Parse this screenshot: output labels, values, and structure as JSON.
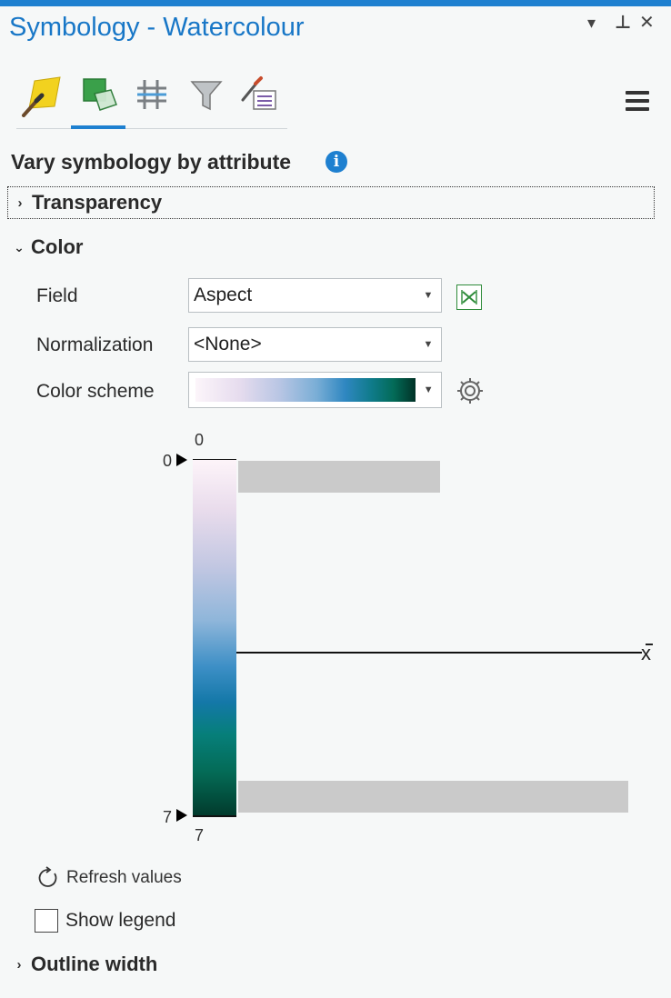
{
  "pane": {
    "title": "Symbology - Watercolour",
    "menu_icon": "chevron-down-icon",
    "pin_icon": "pin-icon",
    "close_icon": "close-icon",
    "menu_glyph": "▾",
    "pin_glyph": "⊥",
    "close_glyph": "✕"
  },
  "tabs": [
    {
      "name": "primary-symbology",
      "icon": "paintbrush-icon"
    },
    {
      "name": "vary-symbology",
      "icon": "layers-icon",
      "active": true
    },
    {
      "name": "symbol-layer-drawing",
      "icon": "grid-icon"
    },
    {
      "name": "masking",
      "icon": "filter-icon"
    },
    {
      "name": "advanced",
      "icon": "list-brush-icon"
    }
  ],
  "heading": "Vary symbology by attribute",
  "sections": {
    "transparency": "Transparency",
    "color": "Color",
    "outline_width": "Outline width"
  },
  "color": {
    "field_label": "Field",
    "field_value": "Aspect",
    "normalization_label": "Normalization",
    "normalization_value": "<None>",
    "scheme_label": "Color scheme",
    "scheme_colors": [
      "#fcf5fa",
      "#b9c6e4",
      "#2f87c1",
      "#036b58",
      "#013227"
    ]
  },
  "histogram": {
    "top_value": "0",
    "top_handle_value": "0",
    "bottom_value": "7",
    "bottom_handle_value": "7",
    "mean_label": "x",
    "bar_fraction_top": 0.51,
    "bar_fraction_bottom": 1.0
  },
  "actions": {
    "refresh_label": "Refresh values",
    "show_legend_label": "Show legend",
    "show_legend_checked": false
  },
  "colors": {
    "accent": "#1e80d0",
    "expression_green": "#2e8b3a"
  }
}
